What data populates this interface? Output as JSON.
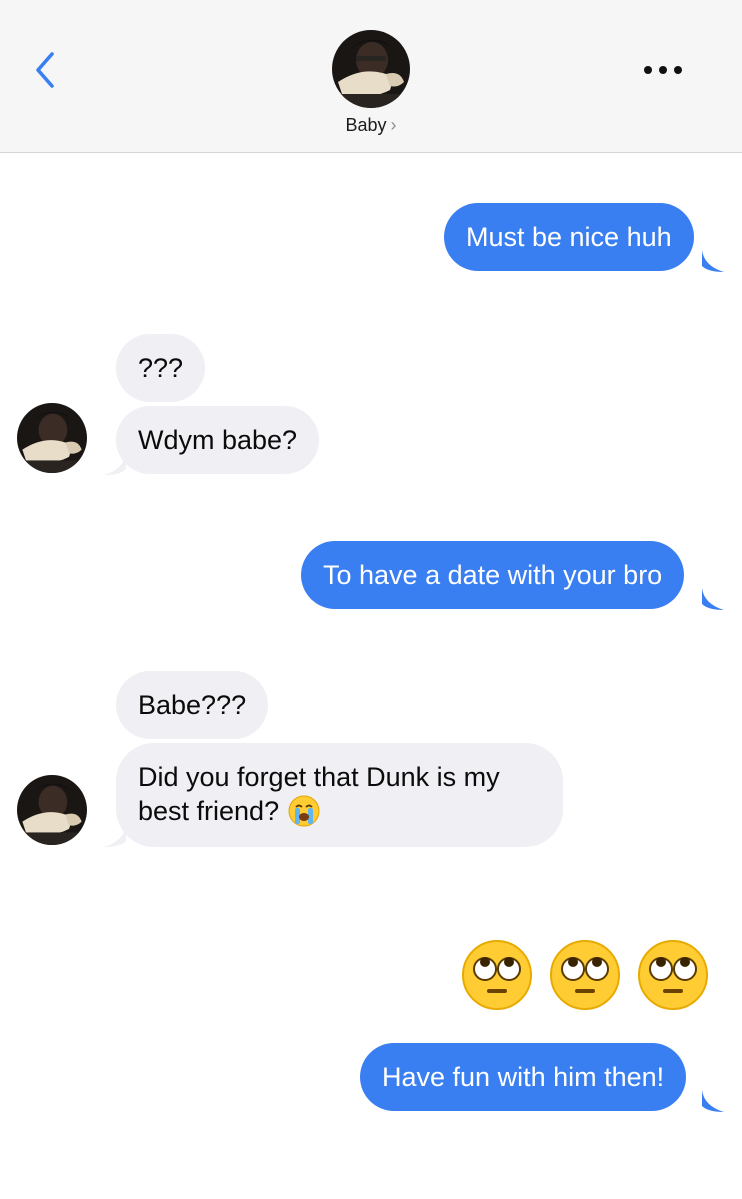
{
  "header": {
    "contact_name": "Baby",
    "chevron": "›",
    "back_icon": "chevron-left-icon",
    "more_icon": "ellipsis-icon"
  },
  "colors": {
    "sent_bubble": "#3a7ff2",
    "received_bubble": "#efeff4",
    "accent": "#3a7ff2"
  },
  "messages": [
    {
      "direction": "sent",
      "text": "Must be nice huh"
    },
    {
      "direction": "received",
      "text": "???"
    },
    {
      "direction": "received",
      "text": "Wdym babe?"
    },
    {
      "direction": "sent",
      "text": "To have a date with your bro"
    },
    {
      "direction": "received",
      "text": "Babe???"
    },
    {
      "direction": "received",
      "text_line1": "Did you forget that Dunk is my",
      "text_line2": "best friend?",
      "emoji": "loudly-crying-face-icon"
    },
    {
      "direction": "sent",
      "emoji_only": [
        "face-with-rolling-eyes-icon",
        "face-with-rolling-eyes-icon",
        "face-with-rolling-eyes-icon"
      ]
    },
    {
      "direction": "sent",
      "text": "Have fun with him then!"
    }
  ]
}
